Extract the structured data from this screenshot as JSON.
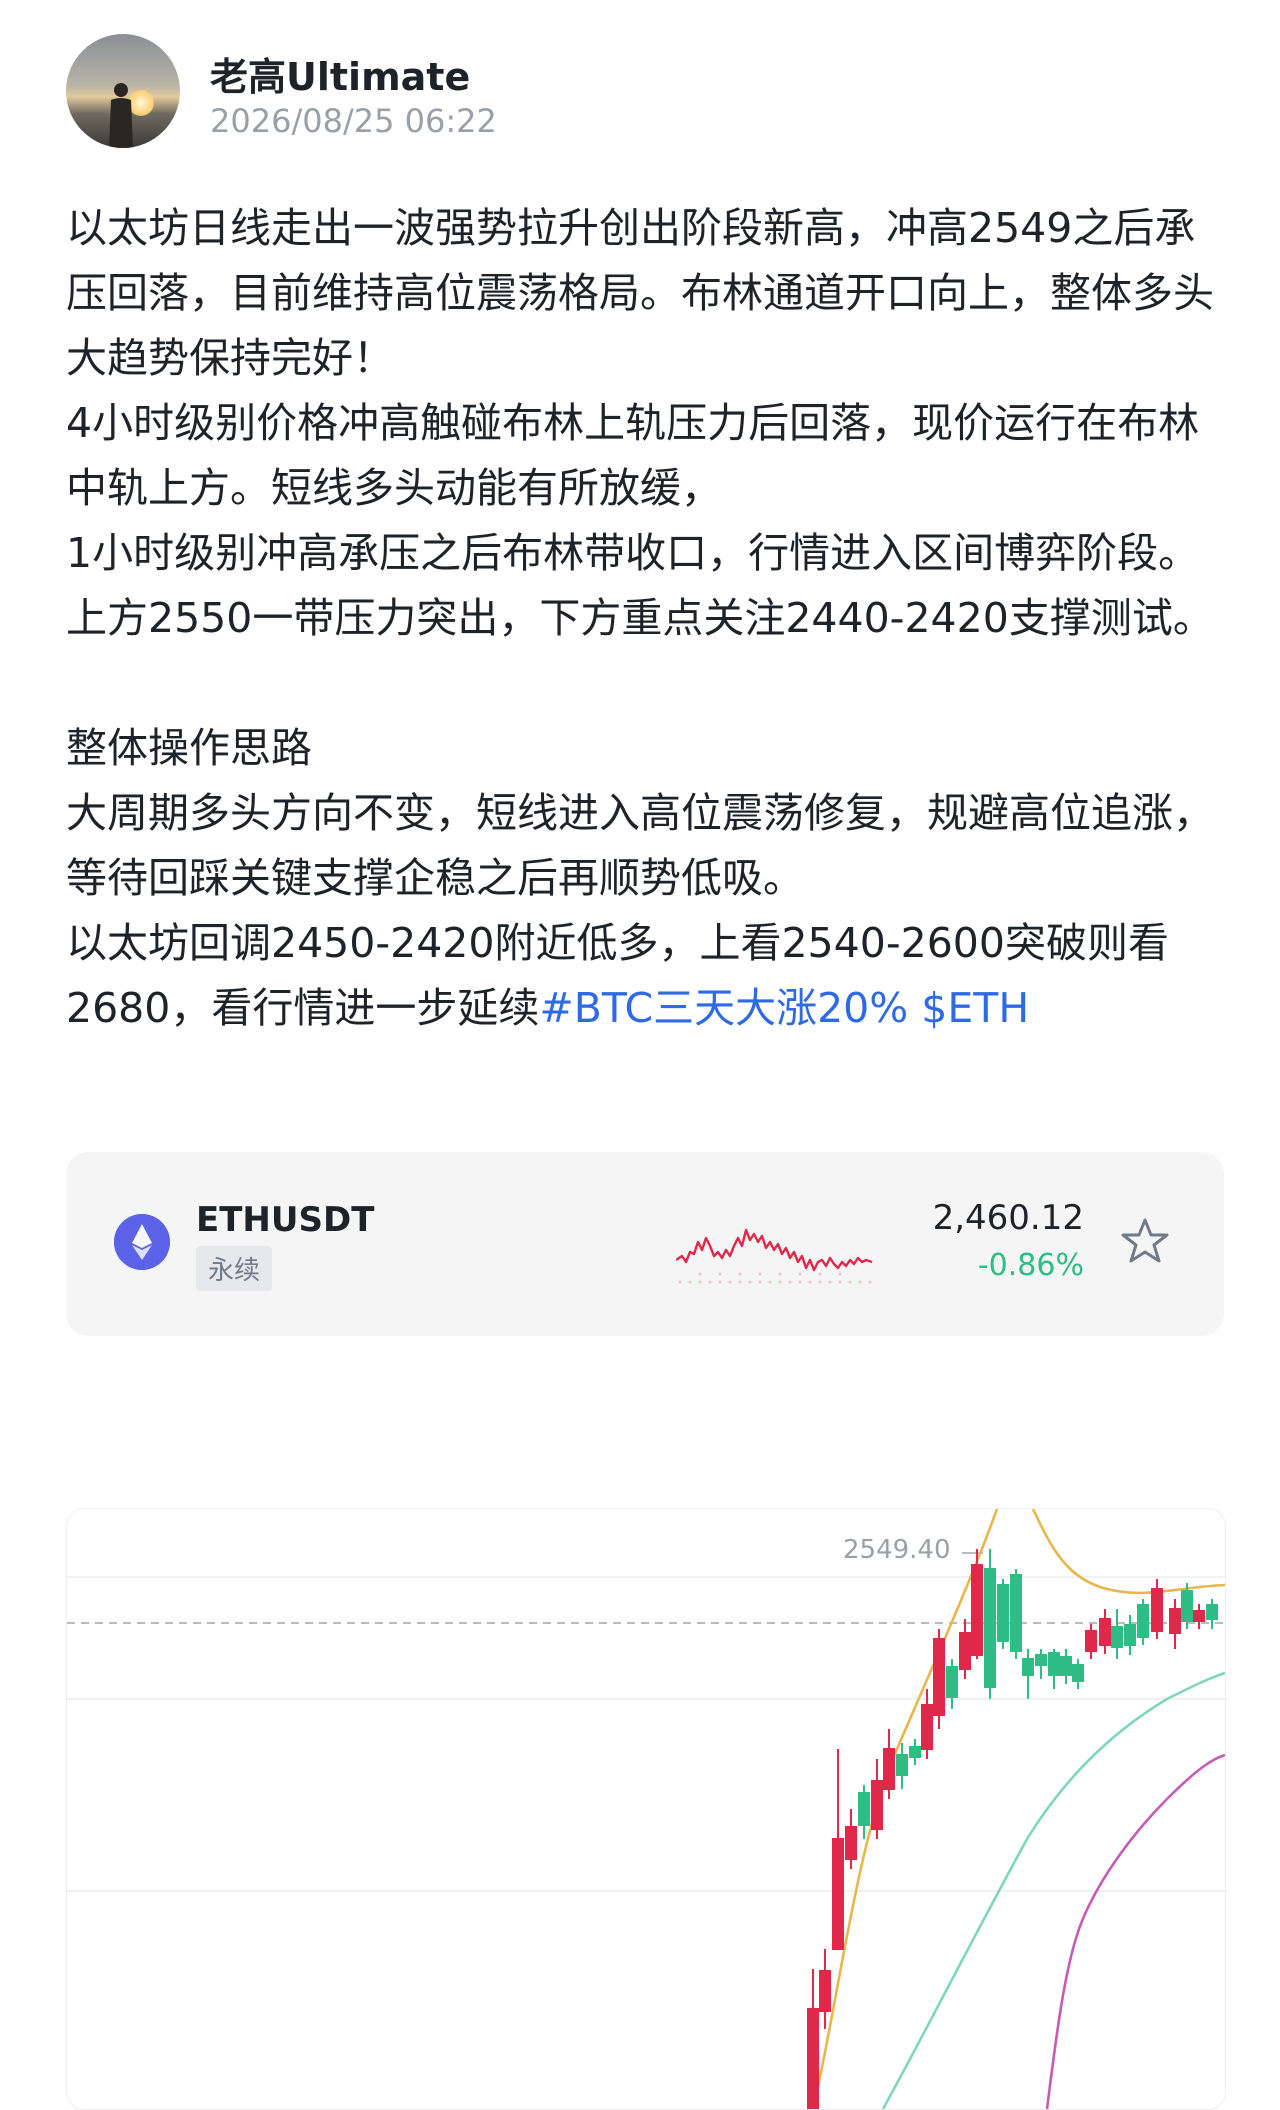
{
  "author": {
    "name": "老高Ultimate",
    "date": "2026/08/25 06:22"
  },
  "post": {
    "lines": [
      "以太坊日线走出一波强势拉升创出阶段新高，冲高2549之后承压回落，目前维持高位震荡格局。布林通道开口向上，整体多头大趋势保持完好！",
      "4小时级别价格冲高触碰布林上轨压力后回落，现价运行在布林中轨上方。短线多头动能有所放缓，",
      "1小时级别冲高承压之后布林带收口，行情进入区间博弈阶段。上方2550一带压力突出，下方重点关注2440-2420支撑测试。",
      "",
      "整体操作思路",
      "大周期多头方向不变，短线进入高位震荡修复，规避高位追涨，等待回踩关键支撑企稳之后再顺势低吸。"
    ],
    "last_line_text": "以太坊回调2450-2420附近低多，上看2540-2600突破则看2680，看行情进一步延续",
    "tags": [
      "#BTC三天大涨20%",
      "$ETH"
    ]
  },
  "ticker": {
    "symbol": "ETHUSDT",
    "contract_type": "永续",
    "price": "2,460.12",
    "change": "-0.86%",
    "icon": "eth-icon",
    "star_icon": "star-outline-icon",
    "colors": {
      "up": "#2ebd85",
      "down": "#e0294a",
      "eth": "#5b62e8"
    }
  },
  "chart": {
    "high_label": "2549.40",
    "colors": {
      "up_candle": "#2ebd85",
      "down_candle": "#e0294a",
      "upper_band": "#e8b64c",
      "middle_band": "#7fd6bf",
      "lower_band": "#c75ab5"
    }
  }
}
